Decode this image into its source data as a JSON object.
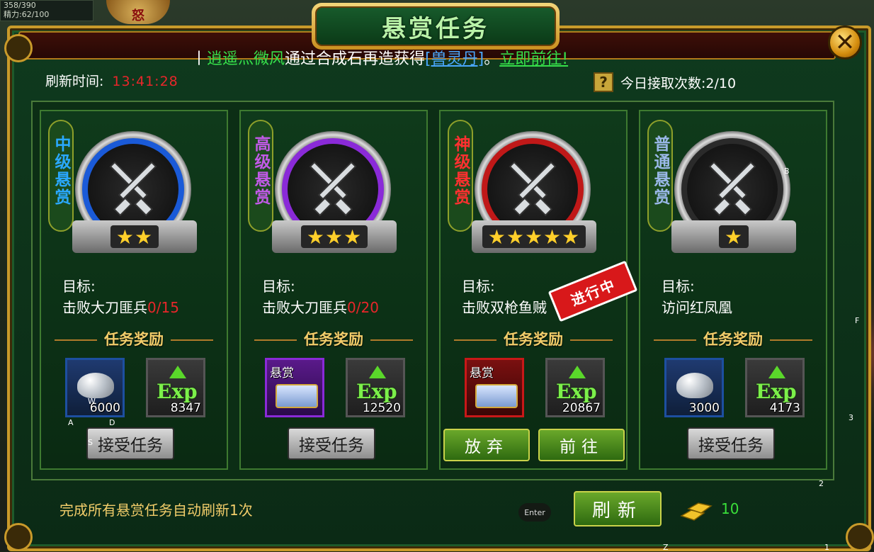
{
  "hud": {
    "hp": "358/390",
    "stamina": "精力:62/100",
    "rage": "怒"
  },
  "window": {
    "title": "悬赏任务",
    "close": "✕"
  },
  "marquee": {
    "prefix": "丨",
    "player": "逍遥灬微风",
    "middle": "通过合成石再造获得",
    "item": "[兽灵丹]",
    "dot": "。",
    "link": "立即前往!"
  },
  "refresh": {
    "label": "刷新时间:",
    "time": "13:41:28"
  },
  "today": {
    "help": "?",
    "label": "今日接取次数:2/10"
  },
  "reward_header": "任务奖励",
  "goal_label": "目标:",
  "cards": [
    {
      "tag": "中级悬赏",
      "tag_color": "#2aa8ff",
      "ring": "#1a5ad8",
      "stars": "★★",
      "goal": "击败大刀匪兵",
      "progress": "0/15",
      "item1": {
        "type": "ingot",
        "label": "",
        "qty": "6000"
      },
      "item2": {
        "qty": "8347"
      },
      "button": "接受任务"
    },
    {
      "tag": "高级悬赏",
      "tag_color": "#c25ae8",
      "ring": "#8a2ad8",
      "stars": "★★★",
      "goal": "击败大刀匪兵",
      "progress": "0/20",
      "item1": {
        "type": "chest",
        "label": "悬赏",
        "qty": ""
      },
      "item2": {
        "qty": "12520"
      },
      "button": "接受任务"
    },
    {
      "tag": "神级悬赏",
      "tag_color": "#ff3030",
      "ring": "#c01818",
      "stars": "★★★★★",
      "goal": "击败双枪鱼贼",
      "progress": "",
      "item1": {
        "type": "chest",
        "label": "悬赏",
        "qty": ""
      },
      "item2": {
        "qty": "20867"
      },
      "stamp": "进行中",
      "buttons": [
        "放弃",
        "前往"
      ]
    },
    {
      "tag": "普通悬赏",
      "tag_color": "#9ab8e8",
      "ring": "#2a2a2a",
      "stars": "★",
      "goal": "访问红凤凰",
      "progress": "",
      "item1": {
        "type": "ingot",
        "label": "",
        "qty": "3000"
      },
      "item2": {
        "qty": "4173"
      },
      "button": "接受任务"
    }
  ],
  "exp_text": "Exp",
  "footer": {
    "note": "完成所有悬赏任务自动刷新1次",
    "refresh": "刷新",
    "gold": "10"
  },
  "keys": {
    "w": "W",
    "a": "A",
    "s": "S",
    "d": "D",
    "b": "B",
    "f": "F",
    "k3": "3",
    "k2": "2",
    "z": "Z",
    "k1": "1",
    "enter": "Enter"
  }
}
